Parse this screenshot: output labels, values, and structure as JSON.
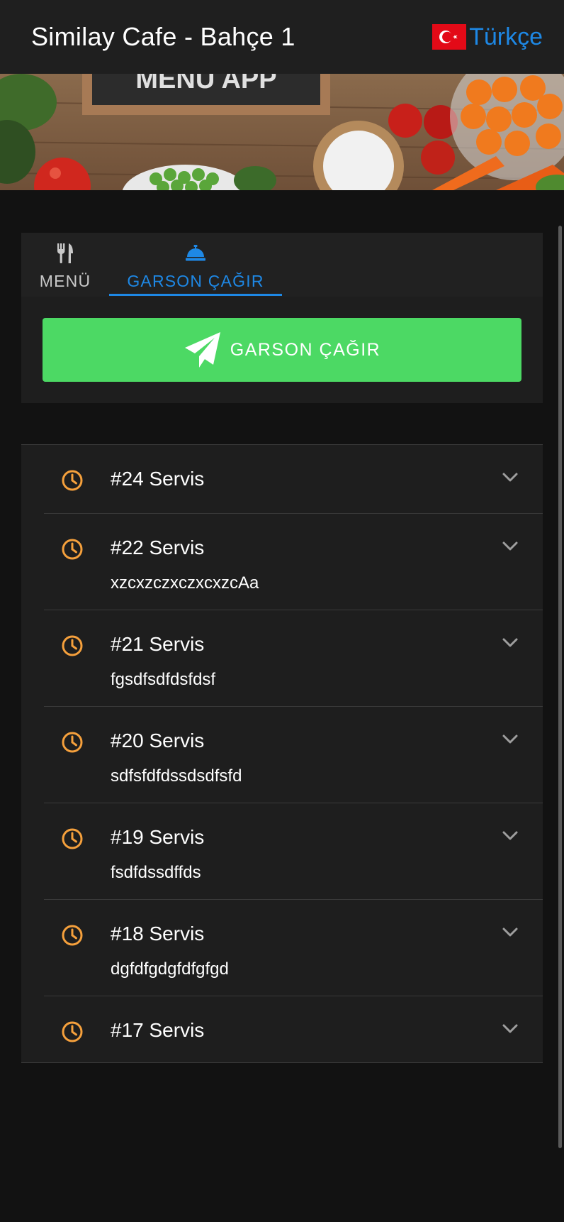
{
  "header": {
    "title": "Similay Cafe - Bahçe 1",
    "language": "Türkçe"
  },
  "banner": {
    "sign_text": "MENU APP"
  },
  "tabs": [
    {
      "label": "MENÜ",
      "icon": "fork-knife-icon",
      "active": false
    },
    {
      "label": "GARSON ÇAĞIR",
      "icon": "service-bell-icon",
      "active": true
    }
  ],
  "call_button": {
    "label": "GARSON ÇAĞIR",
    "icon": "paper-plane-icon",
    "color": "#4cd964"
  },
  "colors": {
    "accent": "#1e88e5",
    "clock": "#f5a03c",
    "surface": "#1e1e1e",
    "background": "#121212"
  },
  "requests": [
    {
      "title": "#24 Servis",
      "note": ""
    },
    {
      "title": "#22 Servis",
      "note": "xzcxzczxczxcxzcAa"
    },
    {
      "title": "#21 Servis",
      "note": "fgsdfsdfdsfdsf"
    },
    {
      "title": "#20 Servis",
      "note": "sdfsfdfdssdsdfsfd"
    },
    {
      "title": "#19 Servis",
      "note": "fsdfdssdffds"
    },
    {
      "title": "#18 Servis",
      "note": "dgfdfgdgfdfgfgd"
    },
    {
      "title": "#17 Servis",
      "note": ""
    }
  ]
}
